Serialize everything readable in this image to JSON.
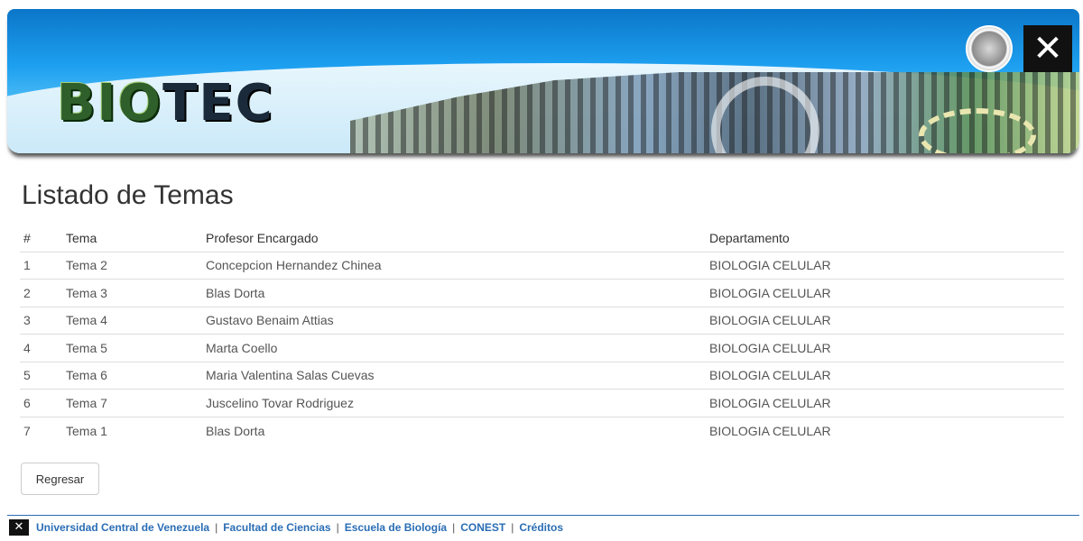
{
  "header": {
    "logo_text_bio": "BIO",
    "logo_text_tec": "TEC"
  },
  "page_title": "Listado de Temas",
  "table": {
    "headers": [
      "#",
      "Tema",
      "Profesor Encargado",
      "Departamento"
    ],
    "rows": [
      [
        "1",
        "Tema 2",
        "Concepcion Hernandez Chinea",
        "BIOLOGIA CELULAR"
      ],
      [
        "2",
        "Tema 3",
        "Blas Dorta",
        "BIOLOGIA CELULAR"
      ],
      [
        "3",
        "Tema 4",
        "Gustavo Benaim Attias",
        "BIOLOGIA CELULAR"
      ],
      [
        "4",
        "Tema 5",
        "Marta Coello",
        "BIOLOGIA CELULAR"
      ],
      [
        "5",
        "Tema 6",
        "Maria Valentina Salas Cuevas",
        "BIOLOGIA CELULAR"
      ],
      [
        "6",
        "Tema 7",
        "Juscelino Tovar Rodriguez",
        "BIOLOGIA CELULAR"
      ],
      [
        "7",
        "Tema 1",
        "Blas Dorta",
        "BIOLOGIA CELULAR"
      ]
    ]
  },
  "back_button_label": "Regresar",
  "footer": {
    "links": [
      "Universidad Central de Venezuela",
      "Facultad de Ciencias",
      "Escuela de Biología",
      "CONEST",
      "Créditos"
    ],
    "separator": "|"
  },
  "colors": {
    "link": "#2a6db5",
    "banner_top": "#0b76c9"
  },
  "icons": {
    "header_seal": "university-seal-icon",
    "header_logo": "ucv-logo-icon",
    "footer_logo": "ucv-logo-icon"
  }
}
